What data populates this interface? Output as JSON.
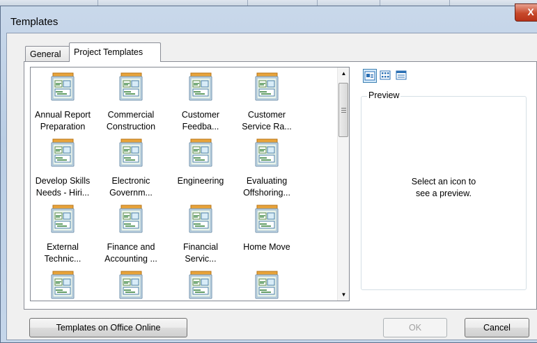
{
  "window": {
    "title": "Templates",
    "close_glyph": "X"
  },
  "tabs": [
    {
      "label": "General",
      "selected": false
    },
    {
      "label": "Project Templates",
      "selected": true
    }
  ],
  "templates": [
    {
      "label": "Annual Report\nPreparation"
    },
    {
      "label": "Commercial\nConstruction"
    },
    {
      "label": "Customer\nFeedba..."
    },
    {
      "label": "Customer\nService Ra..."
    },
    {
      "label": "Develop Skills\nNeeds - Hiri..."
    },
    {
      "label": "Electronic\nGovernm..."
    },
    {
      "label": "Engineering"
    },
    {
      "label": "Evaluating\nOffshoring..."
    },
    {
      "label": "External\nTechnic..."
    },
    {
      "label": "Finance and\nAccounting ..."
    },
    {
      "label": "Financial\nServic..."
    },
    {
      "label": "Home Move"
    },
    {
      "label": ""
    },
    {
      "label": ""
    },
    {
      "label": ""
    },
    {
      "label": ""
    }
  ],
  "view_buttons": [
    {
      "name": "large-icons-view",
      "selected": true
    },
    {
      "name": "list-view",
      "selected": false
    },
    {
      "name": "details-view",
      "selected": false
    }
  ],
  "preview": {
    "legend": "Preview",
    "message": "Select an icon to\nsee a preview."
  },
  "buttons": {
    "office_online": "Templates on Office Online",
    "ok": "OK",
    "cancel": "Cancel"
  },
  "icons": {
    "template": "project-template-icon",
    "scroll_up": "scroll-up-arrow-icon",
    "scroll_down": "scroll-down-arrow-icon"
  }
}
